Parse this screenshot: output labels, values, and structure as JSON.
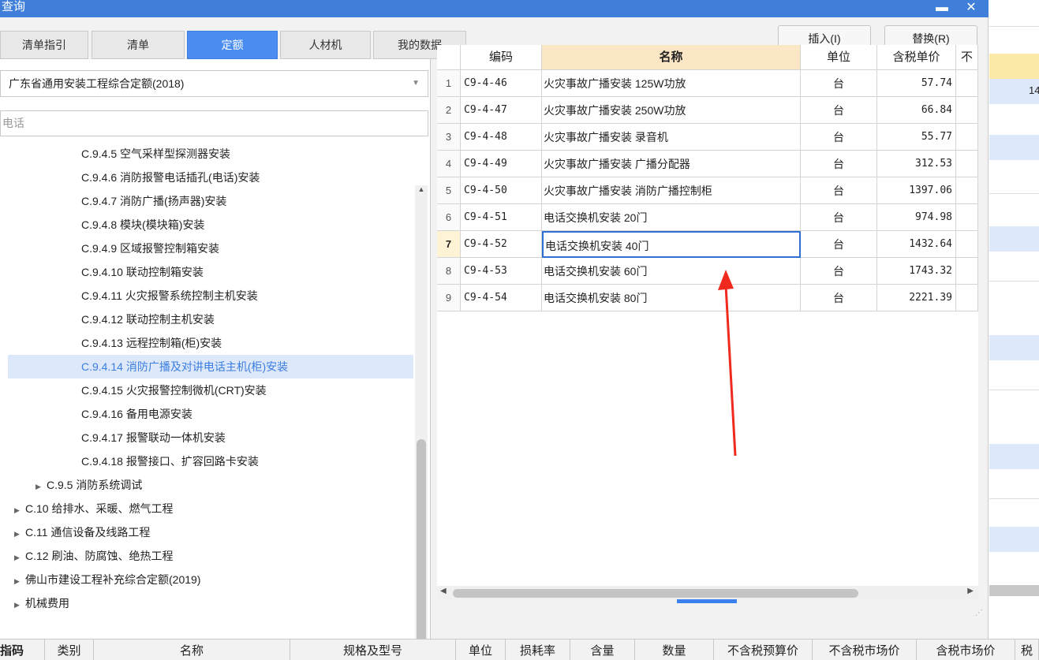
{
  "window": {
    "title": "查询",
    "minimize_glyph": "▬",
    "close_glyph": "✕"
  },
  "tabs": [
    {
      "label": "清单指引",
      "active": false
    },
    {
      "label": "清单",
      "active": false
    },
    {
      "label": "定额",
      "active": true
    },
    {
      "label": "人材机",
      "active": false
    },
    {
      "label": "我的数据",
      "active": false
    }
  ],
  "actions": {
    "insert": "插入(I)",
    "replace": "替换(R)"
  },
  "left": {
    "quota_select": "广东省通用安装工程综合定额(2018)",
    "search_value": "电话",
    "tree": [
      {
        "label": "C.9.4.5 空气采样型探测器安装",
        "arrow": ""
      },
      {
        "label": "C.9.4.6 消防报警电话插孔(电话)安装",
        "arrow": ""
      },
      {
        "label": "C.9.4.7 消防广播(扬声器)安装",
        "arrow": ""
      },
      {
        "label": "C.9.4.8 模块(模块箱)安装",
        "arrow": ""
      },
      {
        "label": "C.9.4.9 区域报警控制箱安装",
        "arrow": ""
      },
      {
        "label": "C.9.4.10 联动控制箱安装",
        "arrow": ""
      },
      {
        "label": "C.9.4.11 火灾报警系统控制主机安装",
        "arrow": ""
      },
      {
        "label": "C.9.4.12 联动控制主机安装",
        "arrow": ""
      },
      {
        "label": "C.9.4.13 远程控制箱(柜)安装",
        "arrow": ""
      },
      {
        "label": "C.9.4.14 消防广播及对讲电话主机(柜)安装",
        "arrow": "",
        "selected": true
      },
      {
        "label": "C.9.4.15 火灾报警控制微机(CRT)安装",
        "arrow": ""
      },
      {
        "label": "C.9.4.16 备用电源安装",
        "arrow": ""
      },
      {
        "label": "C.9.4.17 报警联动一体机安装",
        "arrow": ""
      },
      {
        "label": "C.9.4.18 报警接口、扩容回路卡安装",
        "arrow": ""
      },
      {
        "label": "C.9.5 消防系统调试",
        "arrow": "▶"
      },
      {
        "label": "C.10 给排水、采暖、燃气工程",
        "arrow": "▶"
      },
      {
        "label": "C.11 通信设备及线路工程",
        "arrow": "▶"
      },
      {
        "label": "C.12 刷油、防腐蚀、绝热工程",
        "arrow": "▶"
      },
      {
        "label": "佛山市建设工程补充综合定额(2019)",
        "arrow": "▶"
      },
      {
        "label": "机械费用",
        "arrow": "▶"
      }
    ]
  },
  "grid": {
    "headers": {
      "code": "编码",
      "name": "名称",
      "unit": "单位",
      "price": "含税单价",
      "extra": "不"
    },
    "rows": [
      {
        "idx": "1",
        "code": "C9-4-46",
        "name": "火灾事故广播安装 125W功放",
        "unit": "台",
        "price": "57.74"
      },
      {
        "idx": "2",
        "code": "C9-4-47",
        "name": "火灾事故广播安装 250W功放",
        "unit": "台",
        "price": "66.84"
      },
      {
        "idx": "3",
        "code": "C9-4-48",
        "name": "火灾事故广播安装 录音机",
        "unit": "台",
        "price": "55.77"
      },
      {
        "idx": "4",
        "code": "C9-4-49",
        "name": "火灾事故广播安装 广播分配器",
        "unit": "台",
        "price": "312.53"
      },
      {
        "idx": "5",
        "code": "C9-4-50",
        "name": "火灾事故广播安装 消防广播控制柜",
        "unit": "台",
        "price": "1397.06"
      },
      {
        "idx": "6",
        "code": "C9-4-51",
        "name": "电话交换机安装 20门",
        "unit": "台",
        "price": "974.98"
      },
      {
        "idx": "7",
        "code": "C9-4-52",
        "name": "电话交换机安装 40门",
        "unit": "台",
        "price": "1432.64",
        "current": true
      },
      {
        "idx": "8",
        "code": "C9-4-53",
        "name": "电话交换机安装 60门",
        "unit": "台",
        "price": "1743.32"
      },
      {
        "idx": "9",
        "code": "C9-4-54",
        "name": "电话交换机安装 80门",
        "unit": "台",
        "price": "2221.39"
      }
    ]
  },
  "background": {
    "partial_cell": "14"
  },
  "bottom_headers": [
    "指码",
    "类别",
    "名称",
    "规格及型号",
    "单位",
    "损耗率",
    "含量",
    "数量",
    "不含税预算价",
    "不含税市场价",
    "含税市场价",
    "税"
  ],
  "colors": {
    "accent": "#4a8cf0",
    "titlebar": "#3f7fd9",
    "name_header": "#fbe7c6",
    "annotation_arrow": "#f02a1e"
  }
}
